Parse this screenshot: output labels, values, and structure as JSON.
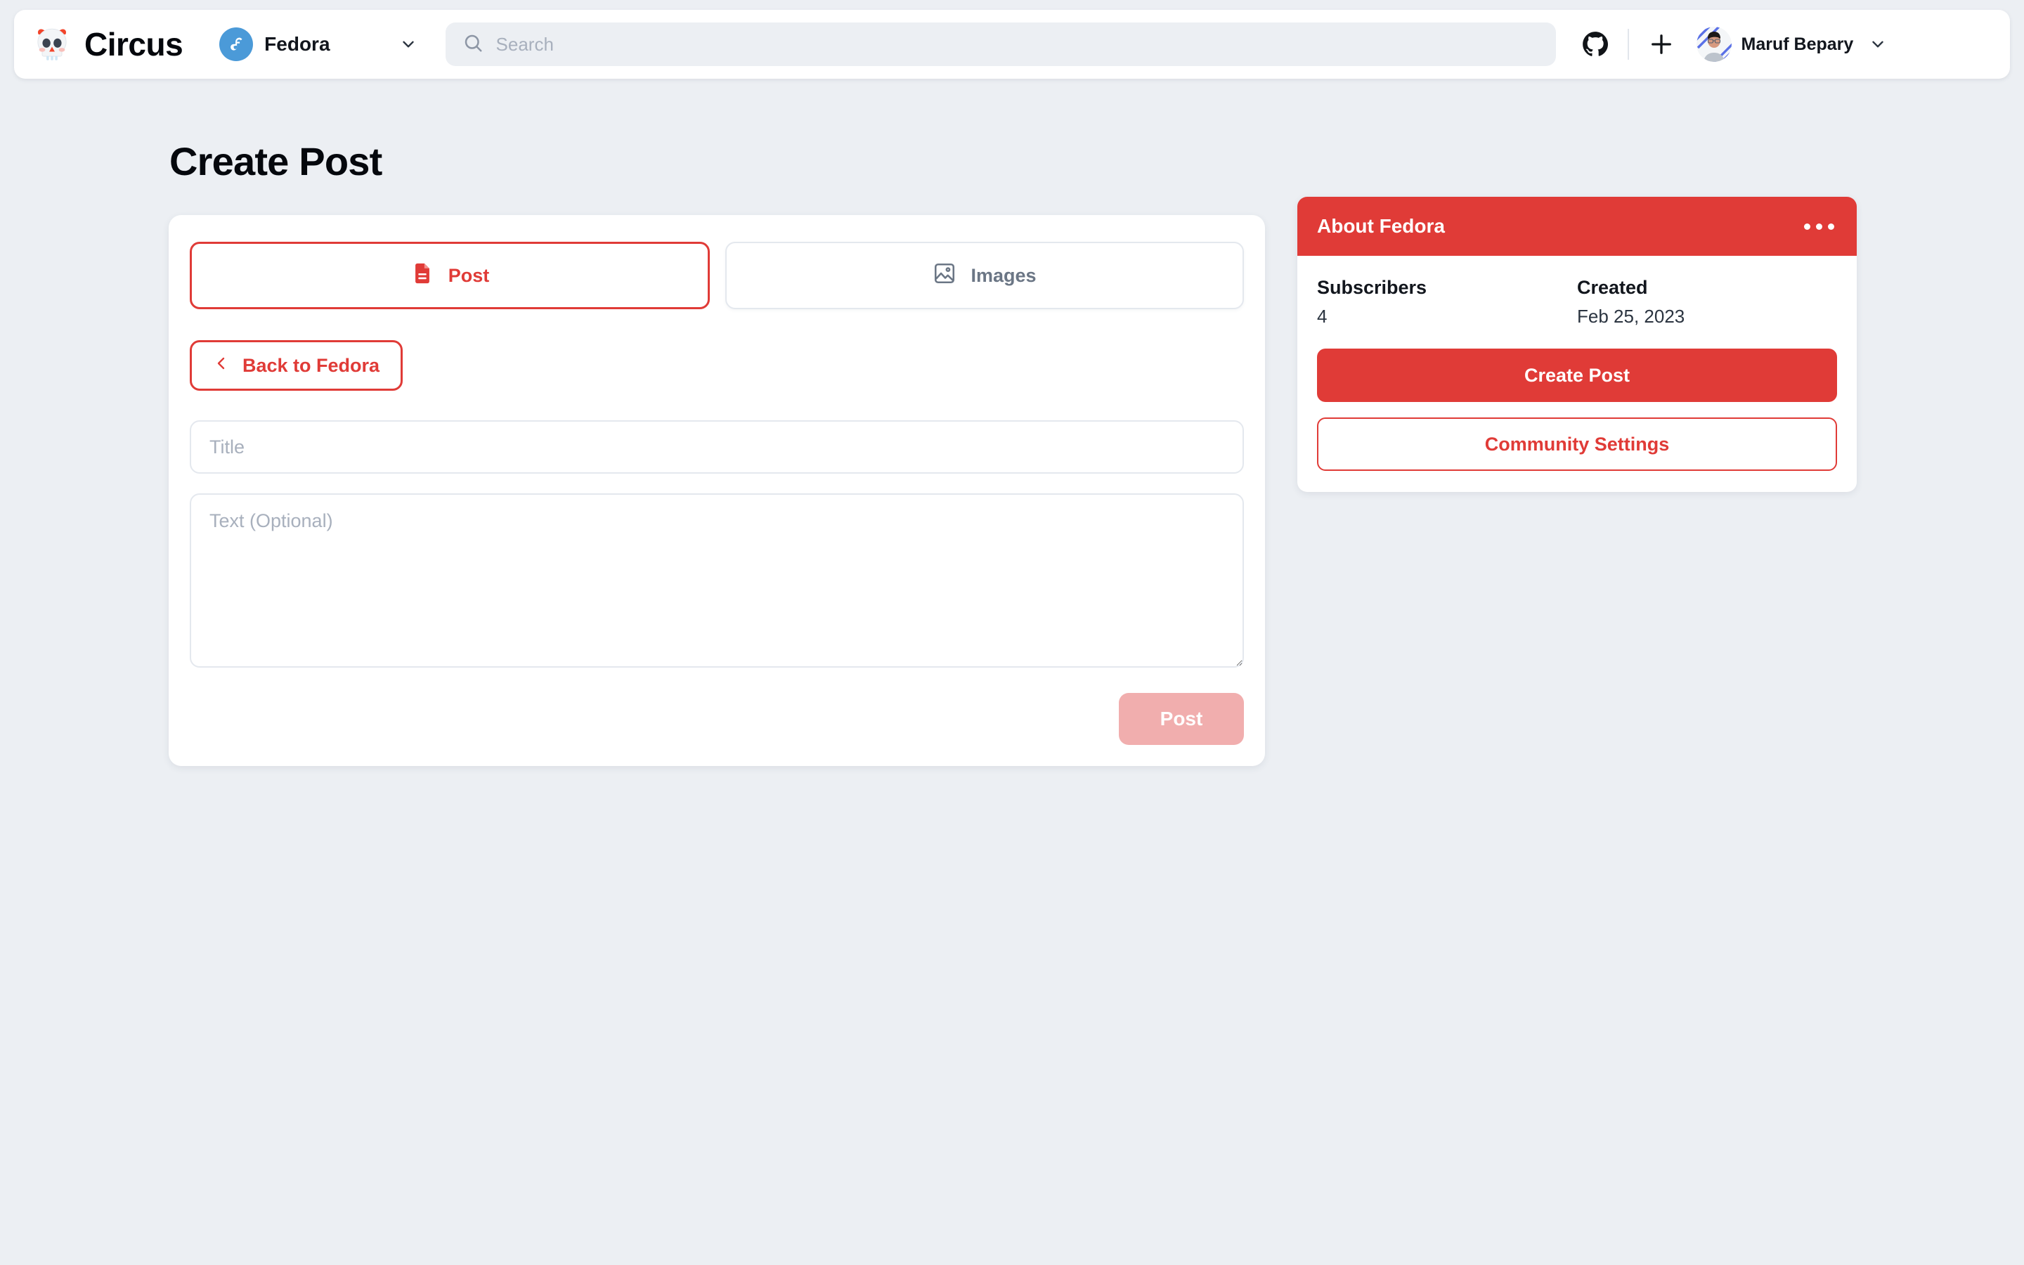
{
  "header": {
    "brand_name": "Circus",
    "brand_logo_icon": "skull-icon",
    "community": {
      "name": "Fedora",
      "logo_icon": "fedora-logo-icon",
      "chevron_icon": "chevron-down-icon"
    },
    "search": {
      "placeholder": "Search",
      "value": "",
      "icon": "search-icon"
    },
    "actions": {
      "github_icon": "github-icon",
      "create_icon": "plus-icon"
    },
    "user": {
      "name": "Maruf Bepary",
      "avatar_icon": "avatar",
      "chevron_icon": "chevron-down-icon"
    }
  },
  "main": {
    "page_title": "Create Post",
    "tabs": [
      {
        "label": "Post",
        "icon": "document-icon",
        "active": true
      },
      {
        "label": "Images",
        "icon": "image-icon",
        "active": false
      }
    ],
    "back_button": {
      "label": "Back to Fedora",
      "icon": "chevron-left-icon"
    },
    "form": {
      "title_placeholder": "Title",
      "title_value": "",
      "text_placeholder": "Text (Optional)",
      "text_value": "",
      "submit_label": "Post",
      "submit_disabled": true
    }
  },
  "sidebar": {
    "card_title": "About Fedora",
    "menu_icon": "more-horizontal-icon",
    "stats": [
      {
        "label": "Subscribers",
        "value": "4"
      },
      {
        "label": "Created",
        "value": "Feb 25, 2023"
      }
    ],
    "create_post_label": "Create Post",
    "community_settings_label": "Community Settings"
  },
  "colors": {
    "accent_red": "#e03b37",
    "accent_red_disabled": "#f1aeae",
    "page_background": "#eceff3",
    "card_background": "#ffffff",
    "fedora_blue": "#4b9ad8",
    "muted_text": "#6b7685"
  }
}
